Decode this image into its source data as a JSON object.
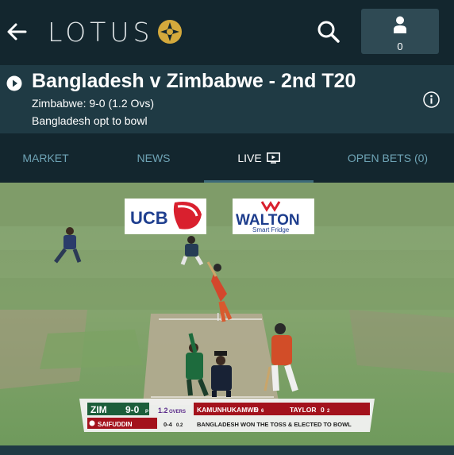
{
  "topbar": {
    "logo_text": "LOTUS",
    "account_count": "0"
  },
  "event": {
    "title": "Bangladesh v Zimbabwe - 2nd T20",
    "score": "Zimbabwe: 9-0 (1.2 Ovs)",
    "status": "Bangladesh opt to bowl"
  },
  "tabs": [
    {
      "label": "MARKET",
      "active": false
    },
    {
      "label": "NEWS",
      "active": false
    },
    {
      "label": "LIVE",
      "active": true
    },
    {
      "label": "OPEN BETS (0)",
      "active": false
    }
  ],
  "video": {
    "sponsor_boards": [
      "UCB",
      "WALTON",
      "Smart Fridge"
    ],
    "scorebar": {
      "team": "ZIM",
      "score": "9-0",
      "score_suffix": "P",
      "overs_value": "1.2",
      "overs_label": "OVERS",
      "batter1": "KAMUNHUKAMWE",
      "batter1_score": "9",
      "batter1_balls": "6",
      "batter2": "TAYLOR",
      "batter2_score": "0",
      "batter2_balls": "2",
      "bowler": "SAIFUDDIN",
      "bowler_figures": "0-4",
      "bowler_overs": "0.2",
      "message": "BANGLADESH WON THE TOSS & ELECTED TO BOWL"
    }
  },
  "colors": {
    "topbar_bg": "#13262e",
    "header_bg": "#1f3a44",
    "tab_inactive": "#6fa4b6",
    "tab_active": "#ffffff",
    "logo_gold": "#d4a93c",
    "scorebar_red": "#a3121c",
    "scorebar_green": "#1c5e3a"
  },
  "icons": [
    "arrow-left-icon",
    "lotus-logo-icon",
    "search-icon",
    "user-icon",
    "play-circle-icon",
    "info-icon",
    "tv-icon"
  ]
}
